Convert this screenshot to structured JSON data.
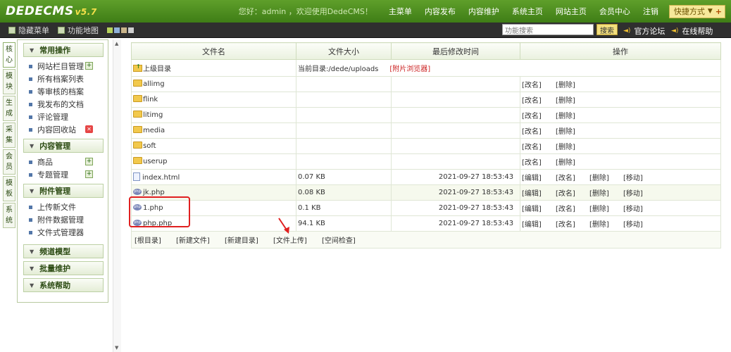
{
  "header": {
    "logo": "DEDECMS",
    "version": "v5.7",
    "welcome": "您好：admin ，欢迎使用DedeCMS！",
    "nav": [
      "主菜单",
      "内容发布",
      "内容维护",
      "系统主页",
      "网站主页",
      "会员中心",
      "注销"
    ],
    "quick_label": "快捷方式"
  },
  "subbar": {
    "hide_menu": "隐藏菜单",
    "func_map": "功能地图",
    "search_placeholder": "功能搜索",
    "search_button": "搜索",
    "forum": "官方论坛",
    "help": "在线帮助"
  },
  "vtabs": [
    [
      "核",
      "心"
    ],
    [
      "模",
      "块"
    ],
    [
      "生",
      "成"
    ],
    [
      "采",
      "集"
    ],
    [
      "会",
      "员"
    ],
    [
      "模",
      "板"
    ],
    [
      "系",
      "统"
    ]
  ],
  "menu": {
    "sections": [
      {
        "title": "常用操作",
        "items": [
          "网站栏目管理",
          "所有档案列表",
          "等审核的档案",
          "我发布的文档",
          "评论管理",
          "内容回收站"
        ]
      },
      {
        "title": "内容管理",
        "items": [
          "商品",
          "专题管理"
        ]
      },
      {
        "title": "附件管理",
        "items": [
          "上传新文件",
          "附件数据管理",
          "文件式管理器"
        ]
      },
      {
        "title": "频道模型",
        "items": []
      },
      {
        "title": "批量维护",
        "items": []
      },
      {
        "title": "系统帮助",
        "items": []
      }
    ]
  },
  "table": {
    "headers": [
      "文件名",
      "文件大小",
      "最后修改时间",
      "操作"
    ],
    "parent_label": "上级目录",
    "current_dir": "当前目录:/dede/uploads",
    "image_browser": "[附片浏览器]",
    "folders": [
      "allimg",
      "flink",
      "litimg",
      "media",
      "soft",
      "userup"
    ],
    "folder_actions": [
      "[改名]",
      "[删除]"
    ],
    "files": [
      {
        "name": "index.html",
        "size": "0.07 KB",
        "time": "2021-09-27 18:53:43"
      },
      {
        "name": "jk.php",
        "size": "0.08 KB",
        "time": "2021-09-27 18:53:43"
      },
      {
        "name": "1.php",
        "size": "0.1 KB",
        "time": "2021-09-27 18:53:43"
      },
      {
        "name": "php.php",
        "size": "94.1 KB",
        "time": "2021-09-27 18:53:43"
      }
    ],
    "file_actions": [
      "[编辑]",
      "[改名]",
      "[删除]",
      "[移动]"
    ],
    "footer_links": [
      "[根目录]",
      "[新建文件]",
      "[新建目录]",
      "[文件上传]",
      "[空间检查]"
    ]
  },
  "colors": {
    "header_green": "#4f8d1f",
    "annotation_red": "#e02020"
  }
}
